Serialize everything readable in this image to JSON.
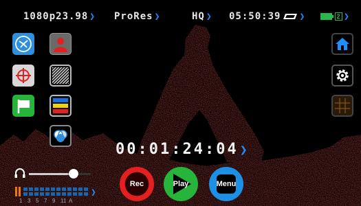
{
  "status_bar": {
    "resolution": "1080p23.98",
    "codec": "ProRes",
    "quality": "HQ",
    "time_remaining": "05:50:39",
    "battery_cells": "2"
  },
  "left_icons": [
    "focus-assist-icon",
    "false-color-icon",
    "frame-guides-icon",
    "zebra-icon",
    "crosshair-icon",
    "tag-flag-icon",
    "lut-icon",
    "color-channels-icon"
  ],
  "right_icons": [
    "home-icon",
    "settings-icon",
    "grid-icon"
  ],
  "timecode": "00:01:24:04",
  "buttons": {
    "rec_label": "Rec",
    "play_label": "Play",
    "menu_label": "Menu"
  },
  "volume_level": 0.72,
  "audio_channels": [
    "1",
    "3",
    "5",
    "7",
    "9",
    "11",
    "A"
  ],
  "colors": {
    "accent": "#1e8fff",
    "rec": "#e3201f",
    "play": "#27b43a",
    "menu": "#1d90e6"
  }
}
